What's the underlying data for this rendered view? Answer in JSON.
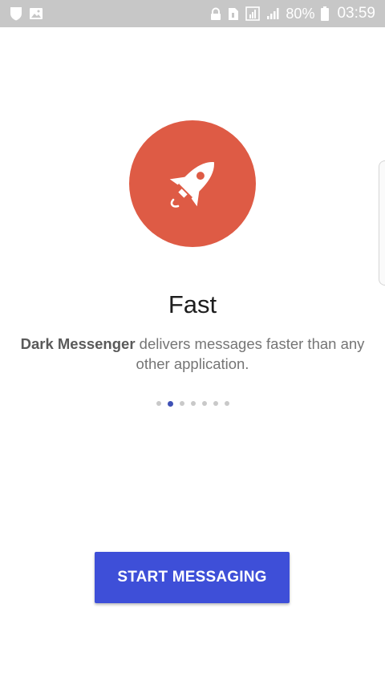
{
  "status_bar": {
    "left_icons": [
      "shield-notification-icon",
      "image-notification-icon"
    ],
    "right_icons": [
      "lock-icon",
      "sim-icon",
      "data-icon",
      "signal-icon",
      "battery-icon"
    ],
    "battery": "80%",
    "time": "03:59"
  },
  "onboarding": {
    "icon": "rocket-icon",
    "title": "Fast",
    "app_name": "Dark Messenger",
    "description_rest": "delivers messages faster than any other application.",
    "page_count": 7,
    "active_page": 1
  },
  "button": {
    "label": "START MESSAGING"
  },
  "colors": {
    "status_bar": "#c7c7c7",
    "hero_circle": "#de5b45",
    "button": "#3e4fd8",
    "active_dot": "#3f51b5",
    "inactive_dot": "#c9c9c9"
  }
}
